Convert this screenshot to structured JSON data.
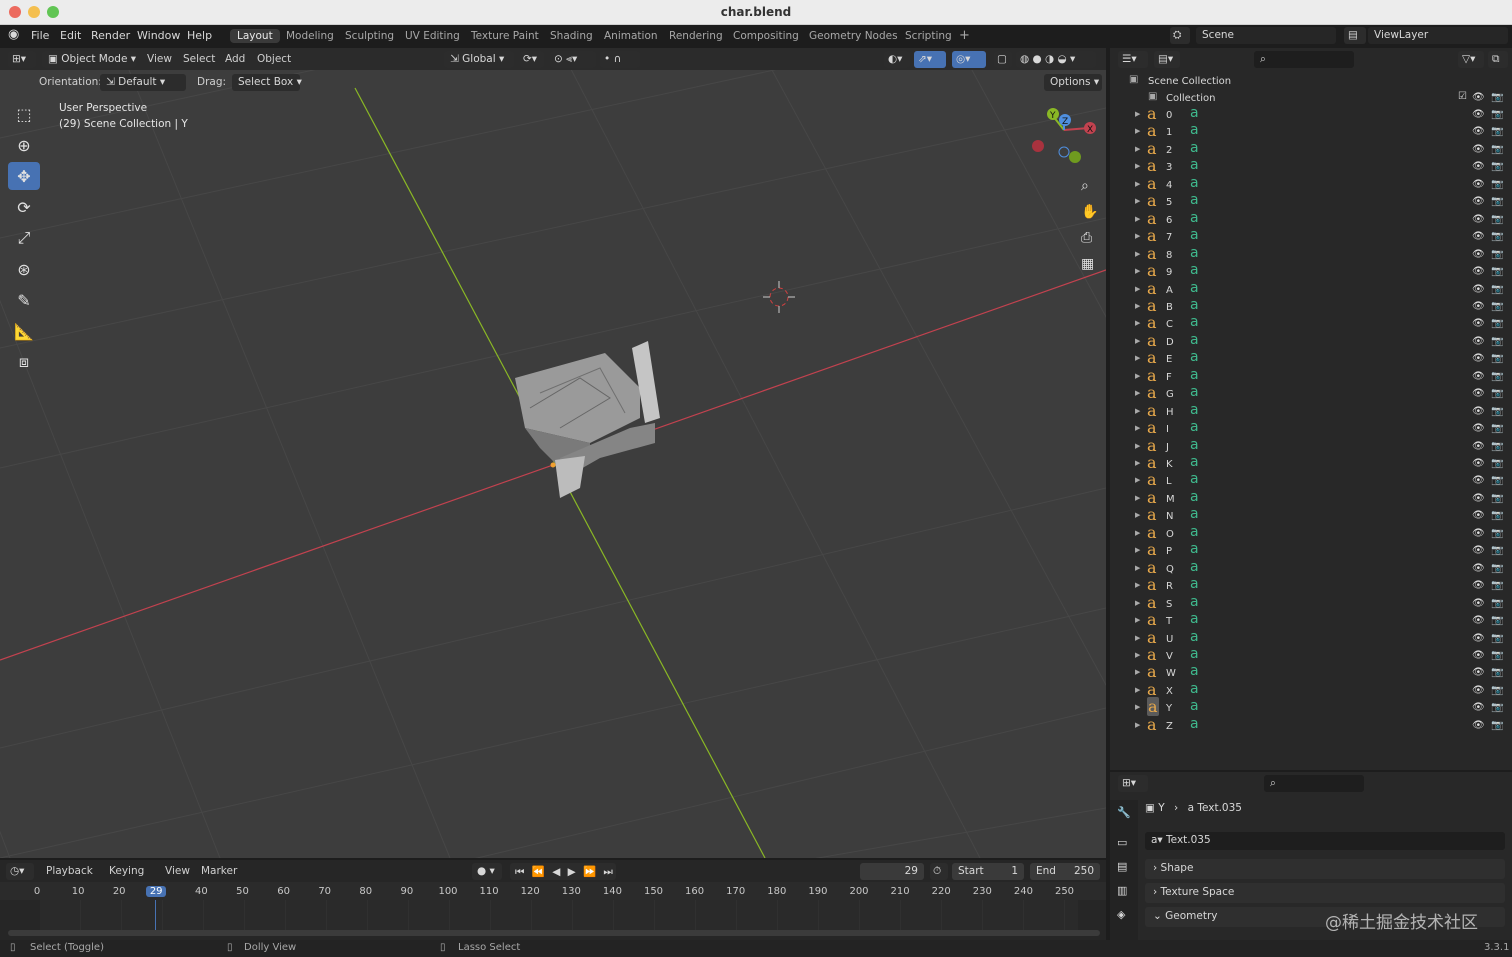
{
  "window": {
    "title": "char.blend"
  },
  "menu": [
    "File",
    "Edit",
    "Render",
    "Window",
    "Help"
  ],
  "workspaces": [
    "Layout",
    "Modeling",
    "Sculpting",
    "UV Editing",
    "Texture Paint",
    "Shading",
    "Animation",
    "Rendering",
    "Compositing",
    "Geometry Nodes",
    "Scripting",
    "+"
  ],
  "scene": {
    "label": "Scene",
    "viewlayer": "ViewLayer"
  },
  "viewport": {
    "mode": "Object Mode",
    "menus": [
      "View",
      "Select",
      "Add",
      "Object"
    ],
    "transform": "Global",
    "orientation_label": "Orientation:",
    "orientation_value": "Default",
    "drag_label": "Drag:",
    "drag_value": "Select Box",
    "options": "Options",
    "perspective": "User Perspective",
    "collection_info": "(29) Scene Collection | Y",
    "gizmo_axes": [
      "Y",
      "Z",
      "X"
    ]
  },
  "outliner": {
    "root": "Scene Collection",
    "collection": "Collection",
    "items": [
      "0",
      "1",
      "2",
      "3",
      "4",
      "5",
      "6",
      "7",
      "8",
      "9",
      "A",
      "B",
      "C",
      "D",
      "E",
      "F",
      "G",
      "H",
      "I",
      "J",
      "K",
      "L",
      "M",
      "N",
      "O",
      "P",
      "Q",
      "R",
      "S",
      "T",
      "U",
      "V",
      "W",
      "X",
      "Y",
      "Z"
    ],
    "selected": "Y",
    "item_icon": "a"
  },
  "properties": {
    "breadcrumb_obj": "Y",
    "breadcrumb_data": "Text.035",
    "data_name": "Text.035",
    "sections": [
      "Shape",
      "Texture Space",
      "Geometry"
    ]
  },
  "timeline": {
    "menus": [
      "Playback",
      "Keying",
      "View",
      "Marker"
    ],
    "current_frame": "29",
    "start_label": "Start",
    "start": "1",
    "end_label": "End",
    "end": "250",
    "ruler": [
      "0",
      "10",
      "20",
      "29",
      "40",
      "50",
      "60",
      "70",
      "80",
      "90",
      "100",
      "110",
      "120",
      "130",
      "140",
      "150",
      "160",
      "170",
      "180",
      "190",
      "200",
      "210",
      "220",
      "230",
      "240",
      "250"
    ]
  },
  "status": {
    "left": "Select (Toggle)",
    "mid": "Dolly View",
    "right": "Lasso Select",
    "version": "3.3.1"
  },
  "watermark": "@稀土掘金技术社区",
  "colors": {
    "accent": "#4772b3",
    "x_axis": "#c2424f",
    "y_axis": "#8ab825",
    "z_axis": "#4f8fdf",
    "text_icon": "#e8a94b",
    "data_icon": "#3fb98d"
  }
}
